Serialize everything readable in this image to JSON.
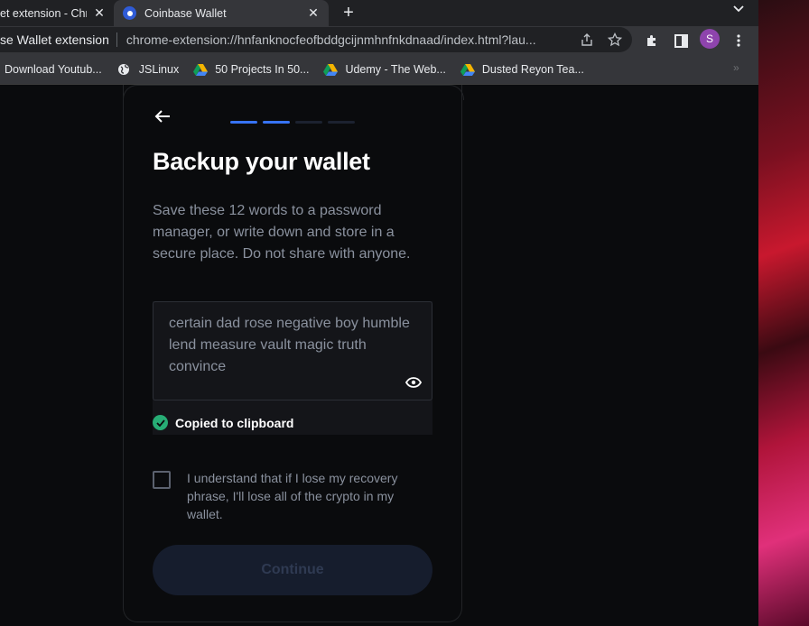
{
  "tabs": [
    {
      "title": "et extension - Chr",
      "active": false
    },
    {
      "title": "Coinbase Wallet",
      "active": true
    }
  ],
  "tab_close_glyph": "✕",
  "new_tab_glyph": "+",
  "omnibox": {
    "site": "se Wallet extension",
    "url": "chrome-extension://hnfanknocfeofbddgcijnmhnfnkdnaad/index.html?lau..."
  },
  "profile_initial": "S",
  "bookmarks": [
    {
      "label": "Download Youtub...",
      "icon": "bookmark-icon"
    },
    {
      "label": "JSLinux",
      "icon": "globe-icon"
    },
    {
      "label": "50 Projects In 50...",
      "icon": "google-drive-icon"
    },
    {
      "label": "Udemy - The Web...",
      "icon": "google-drive-icon"
    },
    {
      "label": "Dusted Reyon Tea...",
      "icon": "google-drive-icon"
    }
  ],
  "bookmarks_overflow": "»",
  "wallet": {
    "progress": {
      "total": 4,
      "completed": 2
    },
    "heading": "Backup your wallet",
    "description": "Save these 12 words to a password manager, or write down and store in a secure place. Do not share with anyone.",
    "recovery_phrase": "certain dad rose negative boy humble lend measure vault magic truth convince",
    "copied_message": "Copied to clipboard",
    "acknowledgement": "I understand that if I lose my recovery phrase, I'll lose all of the crypto in my wallet.",
    "acknowledged": false,
    "continue_label": "Continue",
    "colors": {
      "accent": "#3773f5",
      "success": "#27ad75",
      "muted_text": "#8a919e"
    }
  }
}
